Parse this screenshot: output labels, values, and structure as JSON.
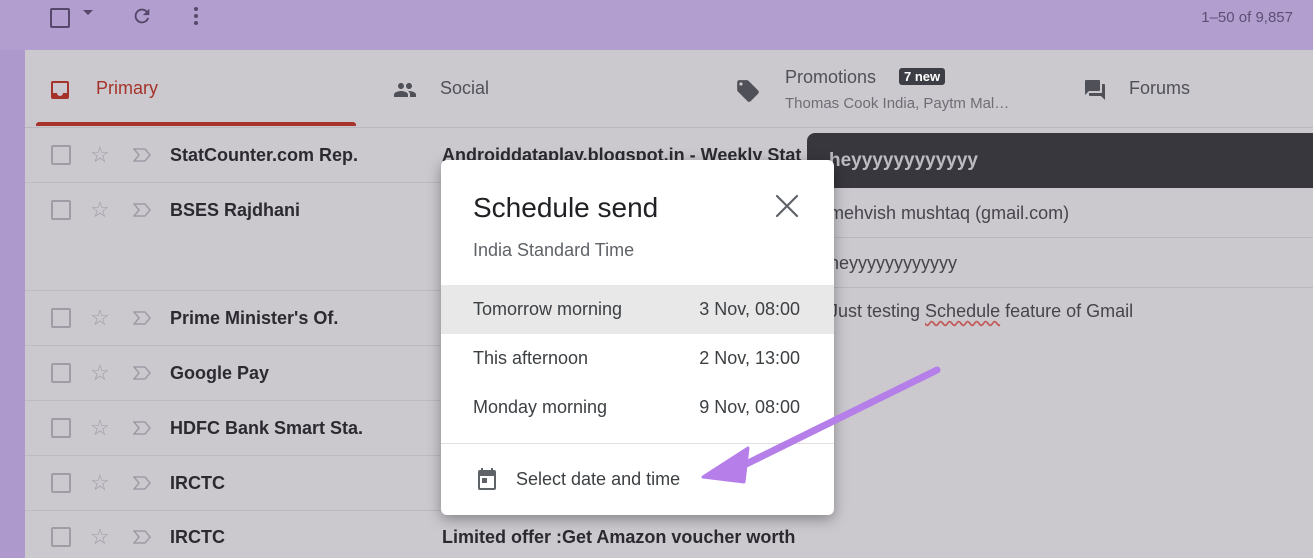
{
  "toolbar": {
    "pagination": "1–50 of 9,857",
    "icons": [
      "select-checkbox",
      "dropdown-caret",
      "refresh-icon",
      "more-vert-icon"
    ]
  },
  "tabs": [
    {
      "label": "Primary",
      "icon": "inbox-icon"
    },
    {
      "label": "Social",
      "icon": "people-icon"
    },
    {
      "label": "Promotions",
      "icon": "tag-icon",
      "badge": "7 new",
      "sub": "Thomas Cook India, Paytm Mal…"
    },
    {
      "label": "Forums",
      "icon": "forum-icon"
    }
  ],
  "rows": [
    {
      "sender": "StatCounter.com Rep.",
      "subject": "Androiddataplay.blogspot.in - Weekly Stat"
    },
    {
      "sender": "BSES Rajdhani",
      "subject": ""
    },
    {
      "sender": "Prime Minister's Of.",
      "subject": ""
    },
    {
      "sender": "Google Pay",
      "subject": ""
    },
    {
      "sender": "HDFC Bank Smart Sta.",
      "subject": ""
    },
    {
      "sender": "IRCTC",
      "subject": ""
    },
    {
      "sender": "IRCTC",
      "subject": "Limited offer :Get Amazon voucher worth"
    }
  ],
  "compose": {
    "header": "heyyyyyyyyyyyy",
    "to": "mehvish mushtaq (gmail.com)",
    "subject": "heyyyyyyyyyyyy",
    "body_pre": "Just testing ",
    "body_misspelled": "Schedule",
    "body_post": " feature of Gmail"
  },
  "dialog": {
    "title": "Schedule send",
    "timezone": "India Standard Time",
    "options": [
      {
        "label": "Tomorrow morning",
        "time": "3 Nov, 08:00",
        "highlighted": true
      },
      {
        "label": "This afternoon",
        "time": "2 Nov, 13:00",
        "highlighted": false
      },
      {
        "label": "Monday morning",
        "time": "9 Nov, 08:00",
        "highlighted": false
      }
    ],
    "select_label": "Select date and time",
    "close_icon": "close-icon",
    "calendar_icon": "calendar-icon"
  },
  "colors": {
    "accent_red": "#a5332a",
    "annotation_arrow": "#b57ee8",
    "overlay": "#b29fcf"
  }
}
